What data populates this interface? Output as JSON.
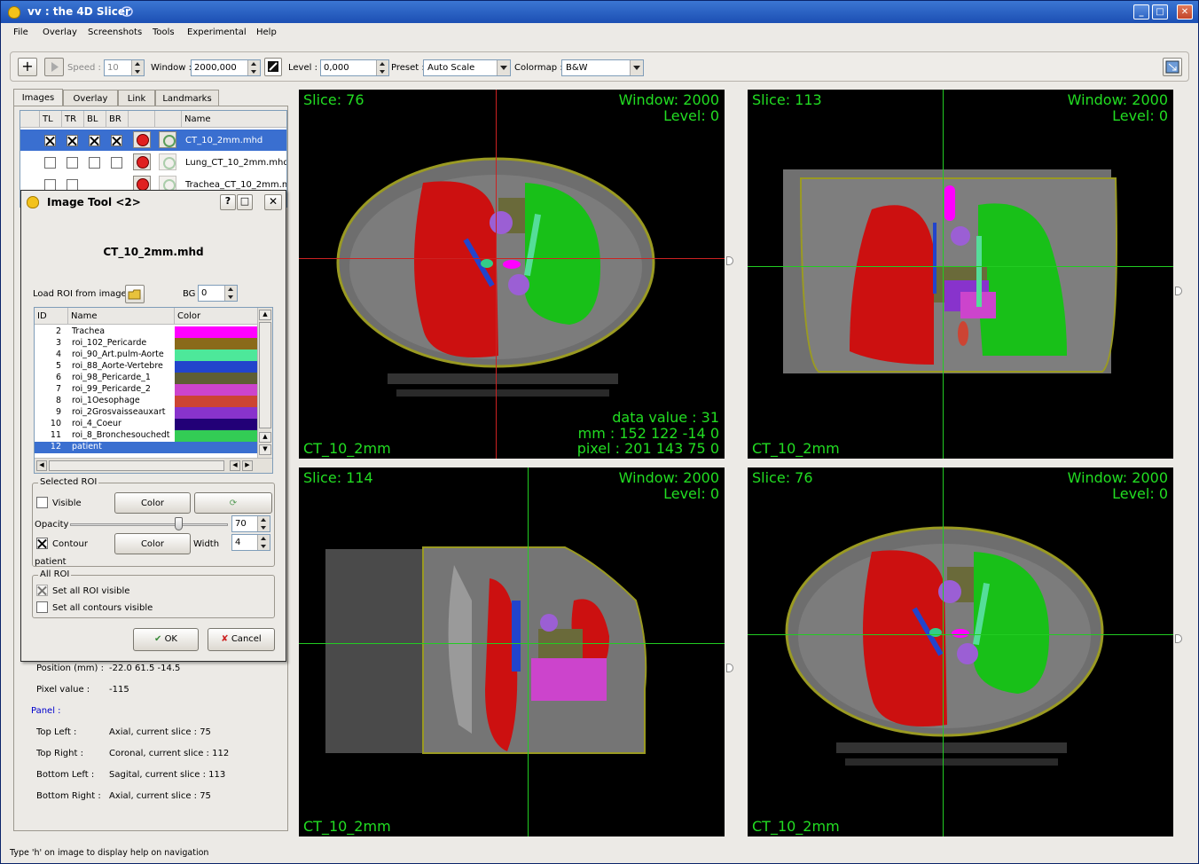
{
  "window": {
    "title": "vv : the 4D Slicer"
  },
  "menu": [
    "File",
    "Overlay",
    "Screenshots",
    "Tools",
    "Experimental",
    "Help"
  ],
  "toolbar": {
    "speed_label": "Speed :",
    "speed_value": "10",
    "window_label": "Window :",
    "window_value": "2000,000",
    "level_label": "Level :",
    "level_value": "0,000",
    "preset_label": "Preset :",
    "preset_value": "Auto Scale",
    "colormap_label": "Colormap :",
    "colormap_value": "B&W"
  },
  "tabs": [
    "Images",
    "Overlay",
    "Link",
    "Landmarks"
  ],
  "image_table": {
    "headers": [
      "TL",
      "TR",
      "BL",
      "BR",
      "",
      "",
      "Name"
    ],
    "rows": [
      {
        "name": "CT_10_2mm.mhd",
        "tl": true,
        "tr": true,
        "bl": true,
        "br": true,
        "selected": true
      },
      {
        "name": "Lung_CT_10_2mm.mhd",
        "tl": false,
        "tr": false,
        "bl": false,
        "br": false,
        "selected": false
      },
      {
        "name": "Trachea_CT_10_2mm.m",
        "tl": false,
        "tr": false,
        "bl": false,
        "br": false,
        "selected": false
      }
    ]
  },
  "info": {
    "position_label": "Position (mm) :",
    "position_value": "-22.0 61.5 -14.5",
    "pixel_label": "Pixel value :",
    "pixel_value": "-115",
    "panel_label": "Panel :",
    "rows": [
      {
        "label": "Top Left :",
        "value": "Axial,   current slice : 75"
      },
      {
        "label": "Top Right :",
        "value": "Coronal, current slice : 112"
      },
      {
        "label": "Bottom Left :",
        "value": "Sagital,  current slice : 113"
      },
      {
        "label": "Bottom Right :",
        "value": "Axial,   current slice : 75"
      }
    ]
  },
  "dialog": {
    "title": "Image Tool <2>",
    "filename": "CT_10_2mm.mhd",
    "load_roi_label": "Load ROI from image",
    "bg_label": "BG",
    "bg_value": "0",
    "roi_headers": [
      "ID",
      "Name",
      "Color"
    ],
    "rois": [
      {
        "id": "2",
        "name": "Trachea",
        "color": "#ff00ff"
      },
      {
        "id": "3",
        "name": "roi_102_Pericarde",
        "color": "#8a6a1a"
      },
      {
        "id": "4",
        "name": "roi_90_Art.pulm-Aorte",
        "color": "#4de89a"
      },
      {
        "id": "5",
        "name": "roi_88_Aorte-Vertebre",
        "color": "#2244cc"
      },
      {
        "id": "6",
        "name": "roi_98_Pericarde_1",
        "color": "#5e5e34"
      },
      {
        "id": "7",
        "name": "roi_99_Pericarde_2",
        "color": "#cc44cc"
      },
      {
        "id": "8",
        "name": "roi_1Oesophage",
        "color": "#cc4433"
      },
      {
        "id": "9",
        "name": "roi_2Grosvaisseauxart",
        "color": "#8833cc"
      },
      {
        "id": "10",
        "name": "roi_4_Coeur",
        "color": "#220077"
      },
      {
        "id": "11",
        "name": "roi_8_Bronchesouchedt",
        "color": "#33cc55"
      },
      {
        "id": "12",
        "name": "patient",
        "color": "#3a6fd0"
      }
    ],
    "selected_roi_label": "Selected ROI",
    "visible_label": "Visible",
    "color_button": "Color",
    "opacity_label": "Opacity",
    "opacity_value": "70",
    "contour_label": "Contour",
    "width_label": "Width",
    "width_value": "4",
    "selected_roi_name": "patient",
    "all_roi_label": "All ROI",
    "set_all_visible": "Set all ROI visible",
    "set_all_contours": "Set all contours visible",
    "ok": "OK",
    "cancel": "Cancel"
  },
  "views": [
    {
      "slice": "Slice: 76",
      "window": "Window: 2000",
      "level": "Level: 0",
      "name": "CT_10_2mm",
      "data_value": "data value : 31",
      "mm": "mm : 152 122 -14 0",
      "pixel": "pixel : 201 143 75 0"
    },
    {
      "slice": "Slice: 113",
      "window": "Window: 2000",
      "level": "Level: 0",
      "name": "CT_10_2mm"
    },
    {
      "slice": "Slice: 114",
      "window": "Window: 2000",
      "level": "Level: 0",
      "name": "CT_10_2mm"
    },
    {
      "slice": "Slice: 76",
      "window": "Window: 2000",
      "level": "Level: 0",
      "name": "CT_10_2mm"
    }
  ],
  "status": "Type 'h' on image to display help on navigation"
}
